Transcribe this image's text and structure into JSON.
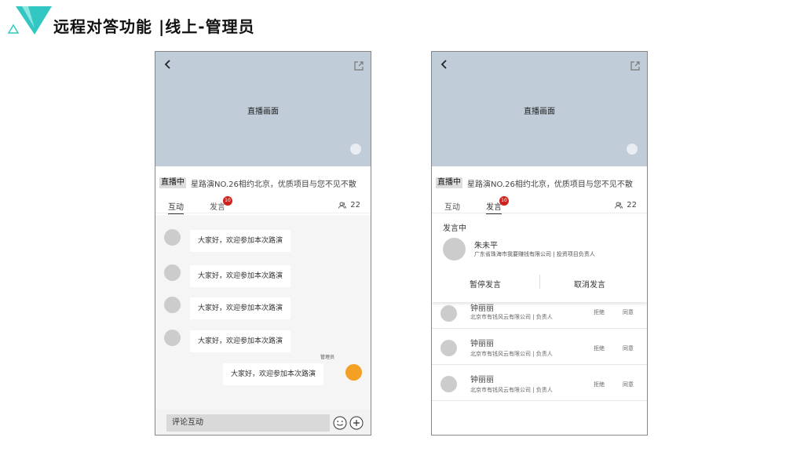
{
  "header": {
    "title": "远程对答功能 |线上-管理员"
  },
  "colors": {
    "logo_teal": "#33c7c4",
    "logo_light": "#8ee6e0",
    "badge_red": "#d0211c",
    "admin_avatar": "#f4a024",
    "video_bg": "#c0ccd8"
  },
  "left_phone": {
    "video_label": "直播画面",
    "live_badge": "直播中",
    "stream_title": "星路演NO.26相约北京，优质项目与您不见不散",
    "tabs": [
      {
        "label": "互动"
      },
      {
        "label": "发言"
      }
    ],
    "speak_badge": "10",
    "viewer_count": "22",
    "messages": [
      {
        "text": "大家好，欢迎参加本次路演"
      },
      {
        "text": "大家好，欢迎参加本次路演"
      },
      {
        "text": "大家好，欢迎参加本次路演"
      },
      {
        "text": "大家好，欢迎参加本次路演"
      }
    ],
    "admin_label": "管理员",
    "admin_message": "大家好，欢迎参加本次路演",
    "comment_placeholder": "评论互动"
  },
  "right_phone": {
    "video_label": "直播画面",
    "live_badge": "直播中",
    "stream_title": "星路演NO.26相约北京，优质项目与您不见不散",
    "tabs": [
      {
        "label": "互动"
      },
      {
        "label": "发言"
      }
    ],
    "speak_badge": "10",
    "viewer_count": "22",
    "speaking_header": "发言中",
    "speaker": {
      "name": "朱未平",
      "org": "广东省珠海市我要赚钱有限公司 | 投资项目负责人"
    },
    "pause_label": "暂停发言",
    "cancel_label": "取消发言",
    "requests": [
      {
        "name": "钟丽丽",
        "org": "北京市有钱风云有限公司 | 负责人",
        "reject": "拒绝",
        "accept": "同意"
      },
      {
        "name": "钟丽丽",
        "org": "北京市有钱风云有限公司 | 负责人",
        "reject": "拒绝",
        "accept": "同意"
      },
      {
        "name": "钟丽丽",
        "org": "北京市有钱风云有限公司 | 负责人",
        "reject": "拒绝",
        "accept": "同意"
      }
    ]
  },
  "icons": [
    "back-icon",
    "share-icon",
    "fullscreen-icon",
    "viewers-icon",
    "emoji-icon",
    "plus-icon"
  ]
}
